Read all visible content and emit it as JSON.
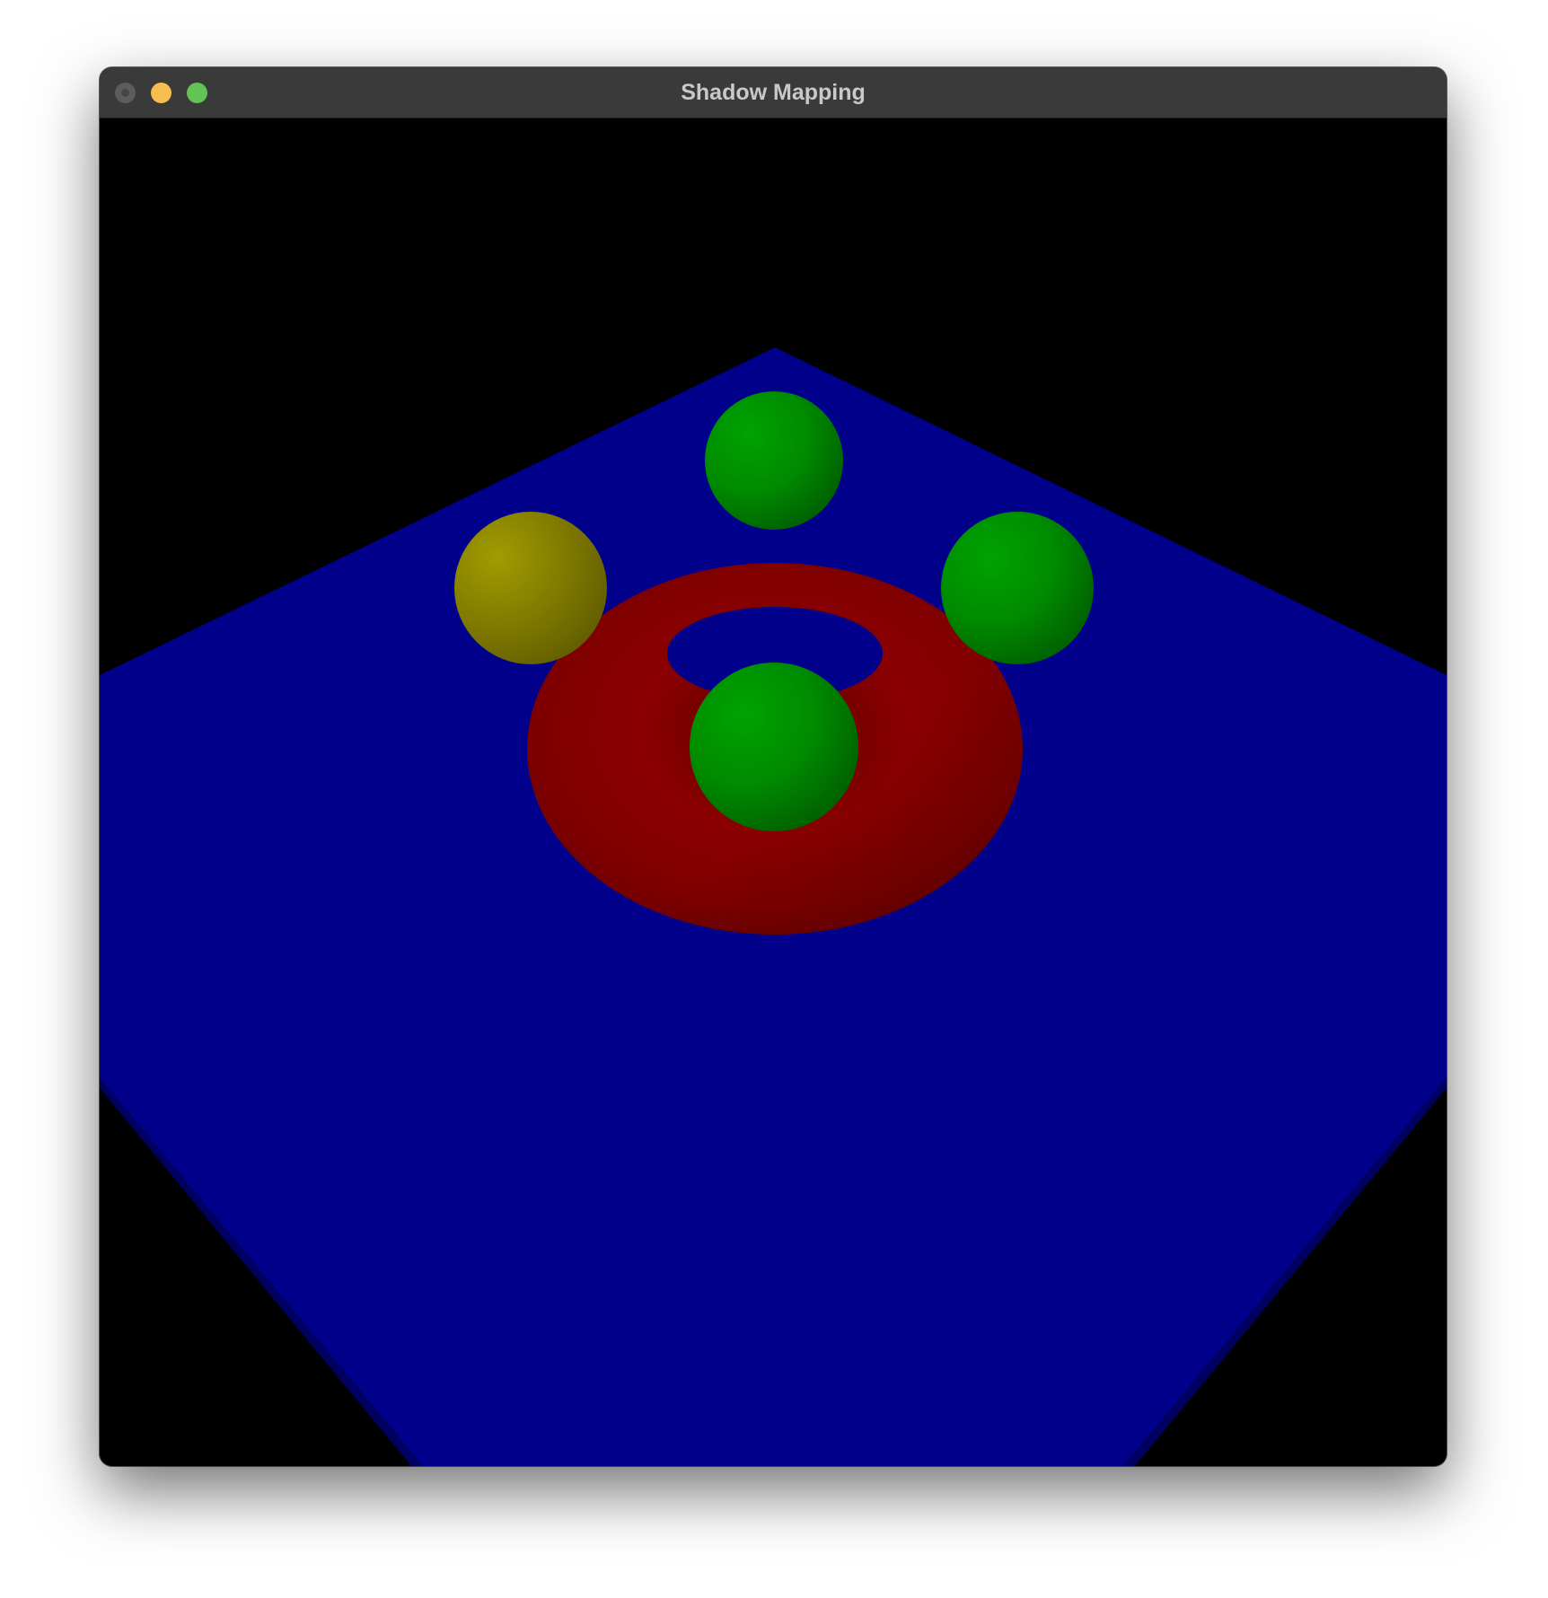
{
  "window": {
    "title": "Shadow Mapping"
  },
  "scene": {
    "background_color": "#000000",
    "floor_color": "#00008b",
    "torus_color": "#8b0000",
    "sphere_colors": [
      "#009100",
      "#009100",
      "#009100",
      "#9b9600"
    ],
    "objects": [
      "floor-plane",
      "torus",
      "sphere",
      "sphere",
      "sphere",
      "sphere"
    ]
  }
}
